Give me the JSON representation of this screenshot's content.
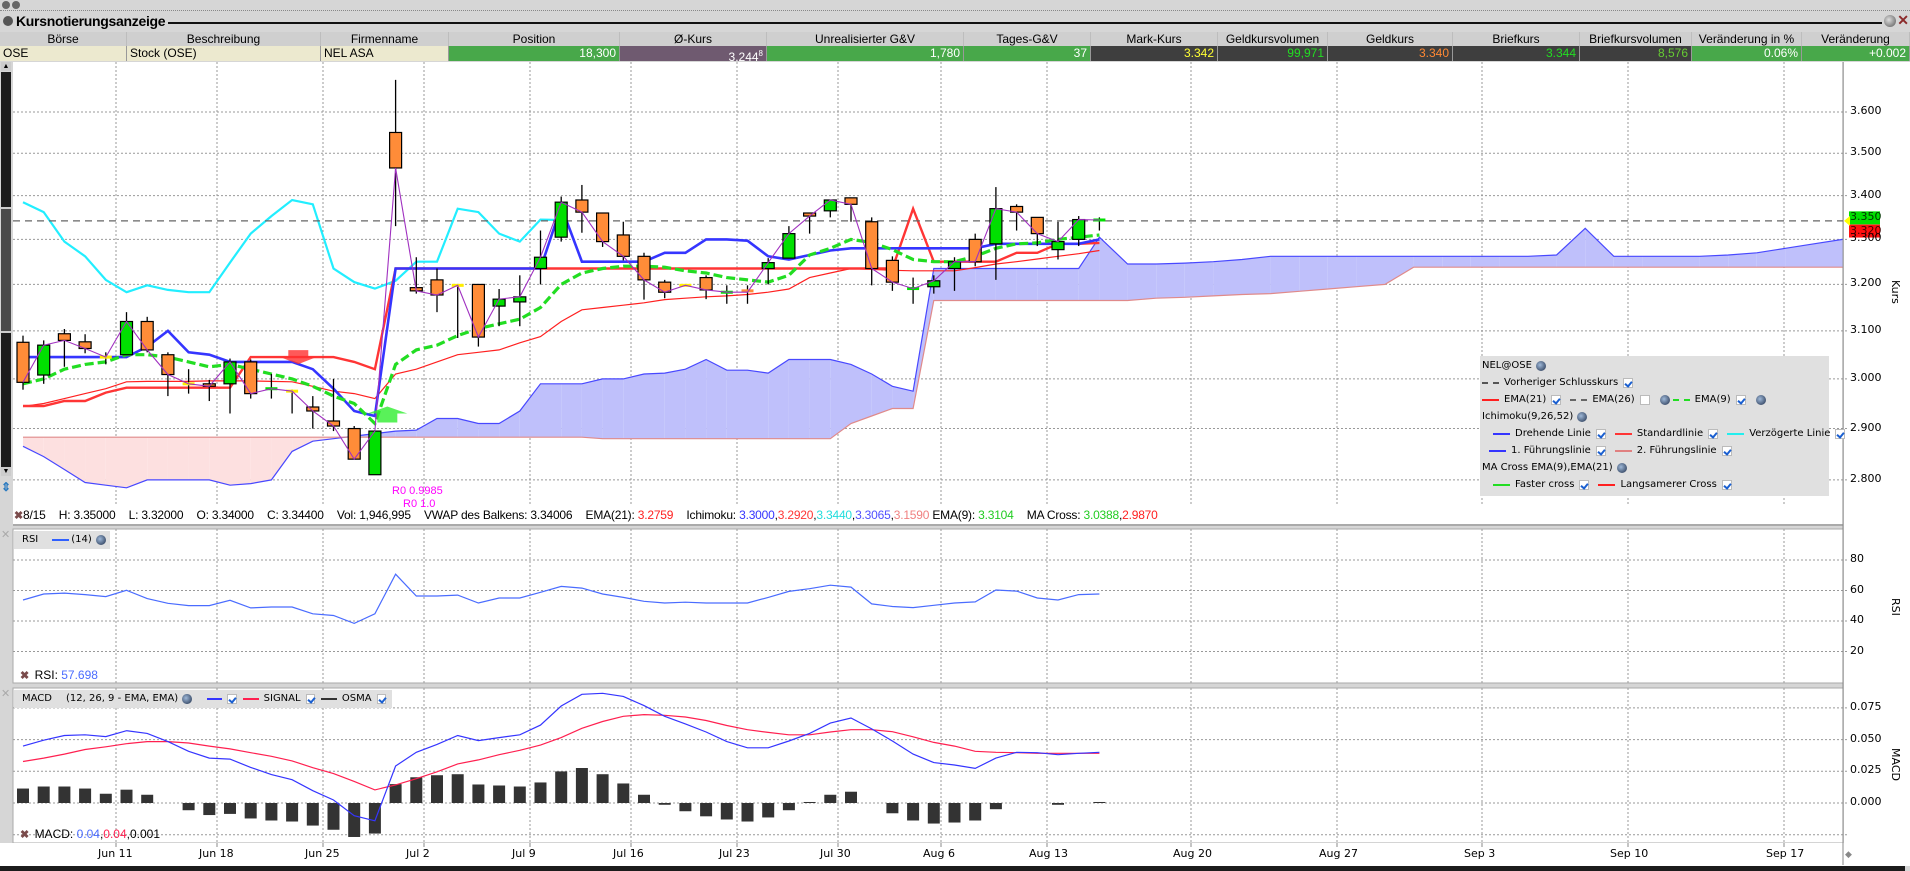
{
  "window": {
    "title": "Kursnotierungsanzeige"
  },
  "quote_table": {
    "headers": [
      "Börse",
      "Beschreibung",
      "Firmenname",
      "Position",
      "Ø-Kurs",
      "Unrealisierter G&V",
      "Tages-G&V",
      "Mark-Kurs",
      "Geldkursvolumen",
      "Geldkurs",
      "Briefkurs",
      "Briefkursvolumen",
      "Veränderung in %",
      "Veränderung"
    ],
    "row": {
      "boerse": "OSE",
      "beschreibung": "Stock (OSE)",
      "firmenname": "NEL ASA",
      "position": "18,300",
      "avg_price": "3.244",
      "avg_price_sup": "8",
      "unrealized_pnl": "1,780",
      "daily_pnl": "37",
      "mark_price": "3.342",
      "bid_size": "99,971",
      "bid": "3.340",
      "ask": "3.344",
      "ask_size": "8,576",
      "change_pct": "0.06%",
      "change": "+0.002"
    },
    "colors": {
      "mark_price": "#ffff33",
      "bid_size": "#22dd22",
      "bid": "#ff8833",
      "ask": "#22dd22",
      "ask_size": "#66cc33"
    }
  },
  "info_bar": {
    "date": "8/15",
    "high": "H: 3.35000",
    "low": "L: 3.32000",
    "open": "O: 3.34000",
    "close": "C: 3.34400",
    "volume": "Vol: 1,946,995",
    "vwap": "VWAP des Balkens: 3.34006",
    "ema21_label": "EMA(21):",
    "ema21_value": "3.2759",
    "ichimoku_label": "Ichimoku:",
    "ichimoku_values": [
      "3.3000",
      "3.2920",
      "3.3440",
      "3.3065",
      "3.1590"
    ],
    "ema9_label": "EMA(9):",
    "ema9_value": "3.3104",
    "ma_cross_label": "MA Cross:",
    "ma_cross_values": [
      "3.0388",
      "2.9870"
    ]
  },
  "legend": {
    "symbol": "NEL@OSE",
    "prev_close": "Vorheriger Schlusskurs",
    "ema21": "EMA(21)",
    "ema26": "EMA(26)",
    "ema9": "EMA(9)",
    "ichimoku": "Ichimoku(9,26,52)",
    "tenkan": "Drehende Linie",
    "kijun": "Standardlinie",
    "chikou": "Verzögerte Linie",
    "senkou_a": "1. Führungslinie",
    "senkou_b": "2. Führungslinie",
    "ma_cross": "MA Cross EMA(9),EMA(21)",
    "faster": "Faster cross",
    "slower": "Langsamerer Cross",
    "checked": {
      "prev_close": true,
      "ema21": true,
      "ema26": false,
      "ema9": true,
      "tenkan": true,
      "kijun": true,
      "chikou": true,
      "senkou_a": true,
      "senkou_b": true,
      "faster": true,
      "slower": true
    }
  },
  "rsi_panel": {
    "title": "RSI",
    "params": "(14)",
    "value_label": "RSI:",
    "value": "57.698"
  },
  "macd_panel": {
    "title": "MACD",
    "params": "(12, 26, 9 - EMA, EMA)",
    "signal": "SIGNAL",
    "osma": "OSMA",
    "value_label": "MACD:",
    "values": [
      "0.04",
      "0.04",
      "0.001"
    ]
  },
  "annotations": {
    "r0_a": "R0 0.9985",
    "r0_b": "R0 1.0"
  },
  "chart_data": {
    "type": "candlestick",
    "symbol": "NEL@OSE",
    "price_axis": {
      "title": "Kurs",
      "ticks": [
        "3.600",
        "3.500",
        "3.400",
        "3.300",
        "3.200",
        "3.100",
        "3.000",
        "2.900",
        "2.800"
      ],
      "scale": "log"
    },
    "date_labels": [
      "Jun 11",
      "Jun 18",
      "Jun 25",
      "Jul 2",
      "Jul 9",
      "Jul 16",
      "Jul 23",
      "Jul 30",
      "Aug 6",
      "Aug 13",
      "Aug 20",
      "Aug 27",
      "Sep 3",
      "Sep 10",
      "Sep 17"
    ],
    "ohlc_columns": [
      "open",
      "high",
      "low",
      "close"
    ],
    "candles": [
      [
        3.076,
        3.09,
        2.978,
        2.993
      ],
      [
        3.008,
        3.08,
        2.99,
        3.07
      ],
      [
        3.094,
        3.104,
        3.025,
        3.08
      ],
      [
        3.077,
        3.093,
        3.053,
        3.063
      ],
      [
        3.045,
        3.055,
        3.03,
        3.045
      ],
      [
        3.05,
        3.14,
        3.05,
        3.12
      ],
      [
        3.12,
        3.13,
        3.055,
        3.06
      ],
      [
        3.05,
        3.055,
        2.965,
        3.009
      ],
      [
        2.99,
        3.02,
        2.97,
        2.99
      ],
      [
        2.99,
        2.998,
        2.955,
        2.985
      ],
      [
        2.99,
        3.042,
        2.93,
        3.035
      ],
      [
        3.035,
        3.04,
        2.96,
        2.97
      ],
      [
        2.975,
        3.01,
        2.96,
        2.98
      ],
      [
        2.975,
        2.978,
        2.93,
        2.975
      ],
      [
        2.943,
        2.965,
        2.9,
        2.935
      ],
      [
        2.915,
        3.0,
        2.895,
        2.905
      ],
      [
        2.9,
        2.905,
        2.84,
        2.84
      ],
      [
        2.81,
        2.897,
        2.81,
        2.895
      ],
      [
        3.55,
        3.68,
        3.33,
        3.465
      ],
      [
        3.193,
        3.26,
        3.18,
        3.186
      ],
      [
        3.21,
        3.235,
        3.14,
        3.177
      ],
      [
        3.198,
        3.198,
        3.085,
        3.198
      ],
      [
        3.2,
        3.2,
        3.067,
        3.087
      ],
      [
        3.153,
        3.19,
        3.11,
        3.168
      ],
      [
        3.162,
        3.22,
        3.11,
        3.173
      ],
      [
        3.235,
        3.32,
        3.2,
        3.26
      ],
      [
        3.305,
        3.398,
        3.295,
        3.385
      ],
      [
        3.39,
        3.425,
        3.315,
        3.362
      ],
      [
        3.36,
        3.36,
        3.283,
        3.295
      ],
      [
        3.31,
        3.34,
        3.253,
        3.262
      ],
      [
        3.262,
        3.27,
        3.167,
        3.21
      ],
      [
        3.205,
        3.21,
        3.17,
        3.183
      ],
      [
        3.198,
        3.2,
        3.195,
        3.198
      ],
      [
        3.215,
        3.22,
        3.168,
        3.188
      ],
      [
        3.18,
        3.198,
        3.158,
        3.183
      ],
      [
        3.186,
        3.198,
        3.158,
        3.183
      ],
      [
        3.235,
        3.258,
        3.2,
        3.248
      ],
      [
        3.258,
        3.33,
        3.258,
        3.313
      ],
      [
        3.36,
        3.36,
        3.313,
        3.353
      ],
      [
        3.365,
        3.39,
        3.35,
        3.39
      ],
      [
        3.395,
        3.395,
        3.34,
        3.38
      ],
      [
        3.34,
        3.35,
        3.198,
        3.235
      ],
      [
        3.253,
        3.262,
        3.186,
        3.205
      ],
      [
        3.19,
        3.215,
        3.158,
        3.191
      ],
      [
        3.195,
        3.22,
        3.18,
        3.208
      ],
      [
        3.235,
        3.26,
        3.186,
        3.25
      ],
      [
        3.3,
        3.313,
        3.24,
        3.25
      ],
      [
        3.29,
        3.42,
        3.21,
        3.37
      ],
      [
        3.375,
        3.38,
        3.32,
        3.362
      ],
      [
        3.35,
        3.35,
        3.285,
        3.313
      ],
      [
        3.277,
        3.34,
        3.255,
        3.295
      ],
      [
        3.3,
        3.353,
        3.285,
        3.345
      ],
      [
        3.34,
        3.35,
        3.32,
        3.344
      ]
    ],
    "previous_close": 3.342,
    "price_tags": [
      {
        "value": "3.350",
        "color": "#00e000"
      },
      {
        "value": "3.320",
        "color": "#ff1010"
      }
    ],
    "ema9": [
      2.99,
      3.0,
      3.02,
      3.03,
      3.035,
      3.05,
      3.05,
      3.045,
      3.035,
      3.025,
      3.03,
      3.02,
      3.01,
      3.0,
      2.985,
      2.965,
      2.95,
      2.91,
      3.03,
      3.06,
      3.07,
      3.09,
      3.105,
      3.115,
      3.125,
      3.15,
      3.2,
      3.225,
      3.235,
      3.24,
      3.24,
      3.238,
      3.23,
      3.225,
      3.215,
      3.21,
      3.205,
      3.22,
      3.265,
      3.28,
      3.3,
      3.293,
      3.277,
      3.255,
      3.25,
      3.25,
      3.262,
      3.28,
      3.29,
      3.292,
      3.3,
      3.305,
      3.31
    ],
    "ema21": [
      2.944,
      2.95,
      2.96,
      2.97,
      2.98,
      2.994,
      2.995,
      2.995,
      2.995,
      2.996,
      2.996,
      2.996,
      2.995,
      2.994,
      2.985,
      2.975,
      2.97,
      2.96,
      3.01,
      3.02,
      3.035,
      3.05,
      3.055,
      3.06,
      3.075,
      3.088,
      3.12,
      3.145,
      3.15,
      3.155,
      3.16,
      3.167,
      3.17,
      3.173,
      3.175,
      3.178,
      3.183,
      3.19,
      3.215,
      3.225,
      3.235,
      3.233,
      3.231,
      3.23,
      3.23,
      3.23,
      3.237,
      3.245,
      3.25,
      3.256,
      3.262,
      3.268,
      3.275
    ],
    "ichimoku": {
      "tenkan": [
        3.045,
        3.045,
        3.045,
        3.045,
        3.045,
        3.045,
        3.067,
        3.1,
        3.055,
        3.05,
        3.035,
        3.035,
        3.035,
        3.035,
        3.02,
        2.98,
        2.935,
        2.925,
        3.235,
        3.235,
        3.235,
        3.235,
        3.235,
        3.235,
        3.235,
        3.235,
        3.375,
        3.25,
        3.25,
        3.25,
        3.25,
        3.27,
        3.27,
        3.3,
        3.3,
        3.297,
        3.262,
        3.255,
        3.265,
        3.275,
        3.28,
        3.28,
        3.28,
        3.28,
        3.28,
        3.28,
        3.28,
        3.29,
        3.29,
        3.29,
        3.29,
        3.29,
        3.3
      ],
      "kijun": [
        2.945,
        2.945,
        2.955,
        2.955,
        2.972,
        2.982,
        2.982,
        2.982,
        2.982,
        2.982,
        2.982,
        3.045,
        3.045,
        3.045,
        3.045,
        3.045,
        3.035,
        3.02,
        3.235,
        3.235,
        3.235,
        3.235,
        3.235,
        3.235,
        3.235,
        3.235,
        3.235,
        3.235,
        3.235,
        3.235,
        3.235,
        3.235,
        3.235,
        3.235,
        3.235,
        3.235,
        3.235,
        3.235,
        3.235,
        3.235,
        3.235,
        3.235,
        3.235,
        3.37,
        3.25,
        3.25,
        3.25,
        3.25,
        3.27,
        3.27,
        3.29,
        3.29,
        3.292
      ],
      "chikou_lag": 26,
      "senkou_a": [
        2.865,
        2.845,
        2.82,
        2.795,
        2.79,
        2.785,
        2.8,
        2.8,
        2.8,
        2.8,
        2.79,
        2.793,
        2.8,
        2.855,
        2.875,
        2.88,
        2.885,
        2.89,
        2.895,
        2.897,
        2.92,
        2.92,
        2.91,
        2.91,
        2.935,
        2.99,
        2.99,
        2.99,
        3.0,
        3.0,
        3.01,
        3.012,
        3.02,
        3.04,
        3.018,
        3.018,
        3.012,
        3.04,
        3.04,
        3.04,
        3.03,
        3.01,
        2.985,
        2.975,
        3.235,
        3.235,
        3.235,
        3.235,
        3.235,
        3.235,
        3.235,
        3.235,
        3.305,
        3.245,
        3.245,
        3.247,
        3.25,
        3.255,
        3.262,
        3.262,
        3.262,
        3.262,
        3.262,
        3.262,
        3.262,
        3.262,
        3.262,
        3.262,
        3.265,
        3.325,
        3.262,
        3.262,
        3.262,
        3.262,
        3.265,
        3.27,
        3.28,
        3.29,
        3.3
      ],
      "senkou_b": [
        2.883,
        2.883,
        2.883,
        2.883,
        2.883,
        2.883,
        2.883,
        2.883,
        2.883,
        2.883,
        2.883,
        2.883,
        2.883,
        2.883,
        2.883,
        2.883,
        2.883,
        2.883,
        2.883,
        2.883,
        2.883,
        2.883,
        2.883,
        2.883,
        2.883,
        2.883,
        2.883,
        2.883,
        2.88,
        2.88,
        2.88,
        2.88,
        2.88,
        2.88,
        2.88,
        2.88,
        2.88,
        2.88,
        2.88,
        2.88,
        2.91,
        2.925,
        2.94,
        2.94,
        3.165,
        3.165,
        3.165,
        3.165,
        3.165,
        3.165,
        3.165,
        3.165,
        3.165,
        3.165,
        3.17,
        3.172,
        3.175,
        3.178,
        3.18,
        3.185,
        3.19,
        3.195,
        3.2,
        3.238,
        3.238,
        3.238,
        3.238,
        3.238,
        3.238,
        3.238,
        3.238,
        3.238,
        3.238,
        3.238,
        3.238,
        3.238,
        3.238,
        3.238,
        3.238
      ]
    },
    "ma_crosses": [
      {
        "type": "slower",
        "index": 13.3,
        "price": 3.045
      },
      {
        "type": "faster",
        "index": 17.6,
        "price": 2.93
      }
    ],
    "rsi": {
      "axis_title": "RSI",
      "ticks": [
        "80",
        "60",
        "40",
        "20"
      ],
      "ylim": [
        0,
        100
      ],
      "values": [
        53.8,
        57.7,
        58.3,
        57.3,
        56,
        60.1,
        54.7,
        51.6,
        50.1,
        50.1,
        53.6,
        48.6,
        49.2,
        49.2,
        44.7,
        43.6,
        38.4,
        44.7,
        70.7,
        56.4,
        56.4,
        57,
        51.8,
        55.1,
        55.1,
        58.8,
        62.7,
        61.6,
        57.7,
        55.5,
        52.9,
        51.8,
        52.3,
        51.8,
        51.8,
        51.8,
        55.5,
        59.4,
        61.2,
        63.5,
        62.2,
        51.2,
        49.5,
        48.8,
        50.3,
        51.8,
        52.5,
        60.3,
        59.6,
        55.1,
        53.8,
        57.3,
        57.7
      ]
    },
    "macd": {
      "axis_title": "MACD",
      "ticks": [
        "0.075",
        "0.050",
        "0.025",
        "0.000"
      ],
      "macd": [
        0.0449,
        0.0495,
        0.0532,
        0.0538,
        0.0524,
        0.057,
        0.0549,
        0.0484,
        0.0408,
        0.0354,
        0.0346,
        0.0281,
        0.0224,
        0.0184,
        0.0097,
        0.0024,
        -0.01,
        -0.014,
        0.0292,
        0.04,
        0.0462,
        0.0532,
        0.0492,
        0.0516,
        0.0538,
        0.0614,
        0.0765,
        0.0857,
        0.0865,
        0.0841,
        0.0768,
        0.0684,
        0.0624,
        0.056,
        0.0484,
        0.0435,
        0.0435,
        0.0489,
        0.0549,
        0.063,
        0.067,
        0.0584,
        0.0489,
        0.0386,
        0.0319,
        0.03,
        0.0273,
        0.0354,
        0.04,
        0.0397,
        0.0381,
        0.0392,
        0.04
      ],
      "signal": [
        0.0327,
        0.0354,
        0.0386,
        0.0422,
        0.0443,
        0.0468,
        0.0484,
        0.0484,
        0.0473,
        0.0449,
        0.0427,
        0.0397,
        0.0368,
        0.0332,
        0.0278,
        0.0232,
        0.017,
        0.0103,
        0.0143,
        0.0192,
        0.0246,
        0.0308,
        0.034,
        0.0381,
        0.0416,
        0.0457,
        0.0516,
        0.0589,
        0.0643,
        0.0684,
        0.0697,
        0.0692,
        0.0678,
        0.0651,
        0.0611,
        0.0578,
        0.0557,
        0.0538,
        0.0538,
        0.056,
        0.0578,
        0.0578,
        0.0562,
        0.0522,
        0.0478,
        0.0449,
        0.0408,
        0.04,
        0.0397,
        0.0392,
        0.0392,
        0.0392,
        0.0392
      ],
      "osma": [
        0.0114,
        0.013,
        0.013,
        0.0114,
        0.0073,
        0.0105,
        0.0065,
        0,
        -0.0057,
        -0.0095,
        -0.0086,
        -0.0122,
        -0.0138,
        -0.0146,
        -0.0178,
        -0.0211,
        -0.0268,
        -0.0241,
        0.0149,
        0.0203,
        0.0219,
        0.0227,
        0.0146,
        0.0138,
        0.013,
        0.0162,
        0.0249,
        0.0276,
        0.0227,
        0.0154,
        0.0065,
        -0.0014,
        -0.0065,
        -0.0105,
        -0.013,
        -0.0146,
        -0.0114,
        -0.0057,
        0.0008,
        0.0065,
        0.0089,
        0,
        -0.0081,
        -0.0138,
        -0.0162,
        -0.0154,
        -0.0138,
        -0.0049,
        0,
        0,
        -0.0014,
        0,
        0.0008
      ]
    },
    "colors": {
      "up": "#00e000",
      "down": "#ff8c38",
      "unchanged": "#ffee00",
      "ema9": "#22dd22",
      "ema21": "#ff2020",
      "tenkan": "#3535ff",
      "kijun": "#ff3535",
      "chikou": "#22eeff",
      "cloud_bull": "#bfc0fb",
      "cloud_bear": "#fde0e0",
      "close_line": "#a030c0",
      "rsi": "#4a6cff",
      "macd": "#3535ff",
      "signal": "#ff2050",
      "osma": "#333333"
    }
  }
}
